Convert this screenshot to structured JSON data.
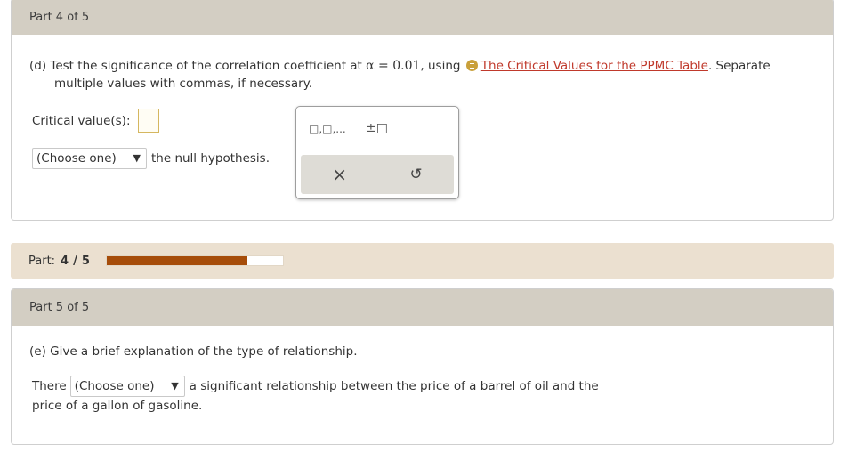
{
  "part4": {
    "header": "Part 4 of 5",
    "question_prefix": "(d) Test the significance of the correlation coefficient at",
    "alpha_expr": "α = 0.01",
    "question_mid": ", using",
    "link_text": "The Critical Values for the PPMC Table",
    "question_suffix": ". Separate",
    "question_line2": "multiple values with commas, if necessary.",
    "critical_label": "Critical value(s):",
    "select_value": "(Choose one)",
    "select_suffix": "the null hypothesis."
  },
  "palette": {
    "list_symbol": "□,□,...",
    "plusminus_symbol": "±□",
    "clear_symbol": "×",
    "undo_symbol": "↺"
  },
  "progress": {
    "label": "Part:",
    "current": "4",
    "separator": "/",
    "total": "5",
    "fraction": 0.8,
    "fill_color": "#a64d0a"
  },
  "part5": {
    "header": "Part 5 of 5",
    "question": "(e) Give a brief explanation of the type of relationship.",
    "there_label": "There",
    "select_value": "(Choose one)",
    "sentence_rest": "a significant relationship between the price of a barrel of oil and the",
    "sentence_line2": "price of a gallon of gasoline."
  }
}
